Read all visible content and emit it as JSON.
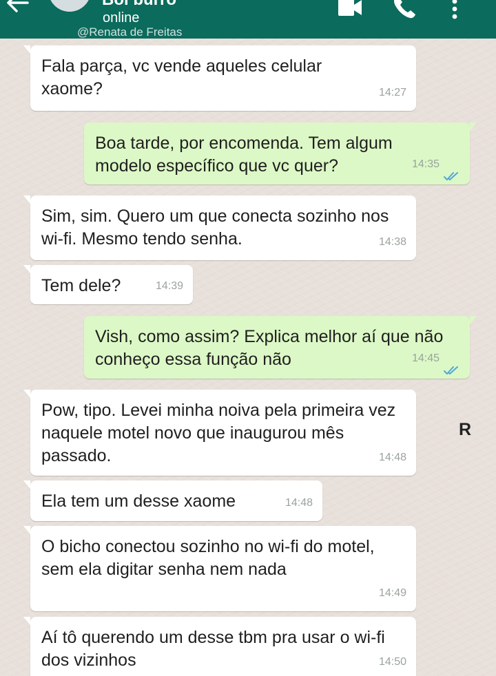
{
  "header": {
    "contact_name": "Boi burro",
    "status": "online",
    "watermark": "@Renata de Freitas"
  },
  "icons": {
    "back": "back-arrow-icon",
    "video": "video-call-icon",
    "call": "phone-call-icon",
    "menu": "more-vert-icon",
    "read": "double-check-icon"
  },
  "colors": {
    "header_bg": "#0b6b5d",
    "incoming_bg": "#ffffff",
    "outgoing_bg": "#dcf8c6",
    "read_check": "#4fa7d8"
  },
  "messages": [
    {
      "direction": "incoming",
      "text": "Fala parça, vc vende aqueles celular xaome?",
      "time": "14:27"
    },
    {
      "direction": "outgoing",
      "text": "Boa tarde, por encomenda. Tem algum modelo específico que vc quer?",
      "time": "14:35",
      "read": true
    },
    {
      "direction": "incoming",
      "text": "Sim, sim. Quero um que conecta sozinho nos wi-fi. Mesmo tendo senha.",
      "time": "14:38"
    },
    {
      "direction": "incoming",
      "text": "Tem dele?",
      "time": "14:39"
    },
    {
      "direction": "outgoing",
      "text": "Vish, como assim? Explica melhor aí que não conheço essa função não",
      "time": "14:45",
      "read": true
    },
    {
      "direction": "incoming",
      "text": "Pow, tipo. Levei minha noiva pela primeira vez naquele motel novo que inaugurou mês passado.",
      "time": "14:48"
    },
    {
      "direction": "incoming",
      "text": "Ela tem um desse xaome",
      "time": "14:48"
    },
    {
      "direction": "incoming",
      "text": "O bicho conectou sozinho no wi-fi do motel, sem ela digitar senha nem nada",
      "time": "14:49"
    },
    {
      "direction": "incoming",
      "text": "Aí tô querendo um desse tbm pra usar o wi-fi dos vizinhos",
      "time": "14:50"
    }
  ],
  "overlay_mark": "R"
}
